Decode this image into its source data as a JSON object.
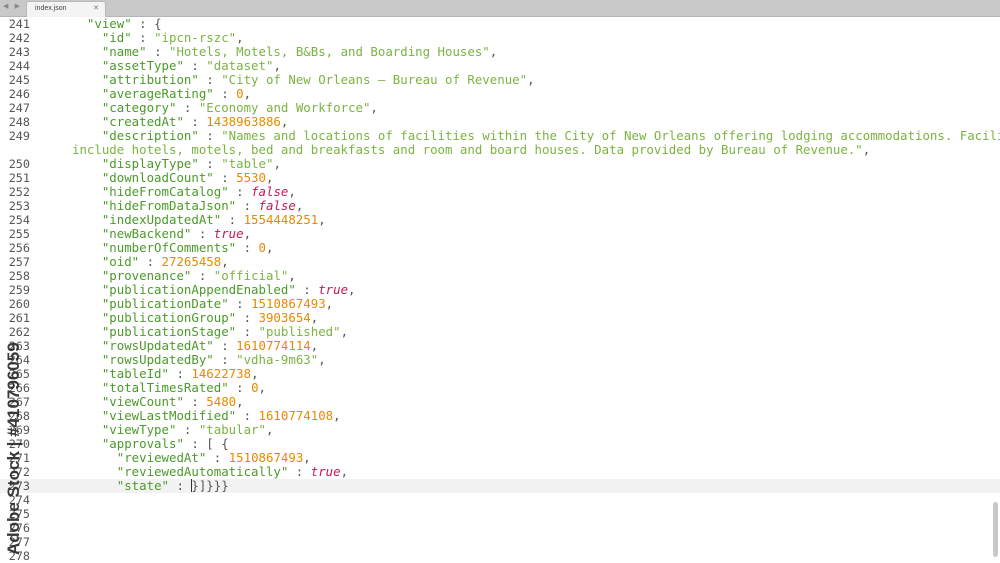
{
  "tab": {
    "label": "index.json",
    "close": "✕",
    "nav": "◀ ▶"
  },
  "watermark": "Adobe Stock | #410796059",
  "lines": [
    {
      "ln": "241",
      "tokens": [
        [
          "p",
          "  "
        ],
        [
          "k",
          "\"view\""
        ],
        [
          "p",
          " : {"
        ]
      ]
    },
    {
      "ln": "242",
      "tokens": [
        [
          "p",
          "    "
        ],
        [
          "k",
          "\"id\""
        ],
        [
          "p",
          " : "
        ],
        [
          "s",
          "\"ipcn-rszc\""
        ],
        [
          "p",
          ","
        ]
      ]
    },
    {
      "ln": "243",
      "tokens": [
        [
          "p",
          "    "
        ],
        [
          "k",
          "\"name\""
        ],
        [
          "p",
          " : "
        ],
        [
          "s",
          "\"Hotels, Motels, B&Bs, and Boarding Houses\""
        ],
        [
          "p",
          ","
        ]
      ]
    },
    {
      "ln": "244",
      "tokens": [
        [
          "p",
          "    "
        ],
        [
          "k",
          "\"assetType\""
        ],
        [
          "p",
          " : "
        ],
        [
          "s",
          "\"dataset\""
        ],
        [
          "p",
          ","
        ]
      ]
    },
    {
      "ln": "245",
      "tokens": [
        [
          "p",
          "    "
        ],
        [
          "k",
          "\"attribution\""
        ],
        [
          "p",
          " : "
        ],
        [
          "s",
          "\"City of New Orleans — Bureau of Revenue\""
        ],
        [
          "p",
          ","
        ]
      ]
    },
    {
      "ln": "246",
      "tokens": [
        [
          "p",
          "    "
        ],
        [
          "k",
          "\"averageRating\""
        ],
        [
          "p",
          " : "
        ],
        [
          "n",
          "0"
        ],
        [
          "p",
          ","
        ]
      ]
    },
    {
      "ln": "247",
      "tokens": [
        [
          "p",
          "    "
        ],
        [
          "k",
          "\"category\""
        ],
        [
          "p",
          " : "
        ],
        [
          "s",
          "\"Economy and Workforce\""
        ],
        [
          "p",
          ","
        ]
      ]
    },
    {
      "ln": "248",
      "tokens": [
        [
          "p",
          "    "
        ],
        [
          "k",
          "\"createdAt\""
        ],
        [
          "p",
          " : "
        ],
        [
          "n",
          "1438963886"
        ],
        [
          "p",
          ","
        ]
      ]
    },
    {
      "ln": "249",
      "tokens": [
        [
          "p",
          "    "
        ],
        [
          "k",
          "\"description\""
        ],
        [
          "p",
          " : "
        ],
        [
          "s",
          "\"Names and locations of facilities within the City of New Orleans offering lodging accommodations. Facilities"
        ]
      ]
    },
    {
      "ln": "",
      "tokens": [
        [
          "s",
          "include hotels, motels, bed and breakfasts and room and board houses. Data provided by Bureau of Revenue.\""
        ],
        [
          "p",
          ","
        ]
      ]
    },
    {
      "ln": "250",
      "tokens": [
        [
          "p",
          "    "
        ],
        [
          "k",
          "\"displayType\""
        ],
        [
          "p",
          " : "
        ],
        [
          "s",
          "\"table\""
        ],
        [
          "p",
          ","
        ]
      ]
    },
    {
      "ln": "251",
      "tokens": [
        [
          "p",
          "    "
        ],
        [
          "k",
          "\"downloadCount\""
        ],
        [
          "p",
          " : "
        ],
        [
          "n",
          "5530"
        ],
        [
          "p",
          ","
        ]
      ]
    },
    {
      "ln": "252",
      "tokens": [
        [
          "p",
          "    "
        ],
        [
          "k",
          "\"hideFromCatalog\""
        ],
        [
          "p",
          " : "
        ],
        [
          "b",
          "false"
        ],
        [
          "p",
          ","
        ]
      ]
    },
    {
      "ln": "253",
      "tokens": [
        [
          "p",
          "    "
        ],
        [
          "k",
          "\"hideFromDataJson\""
        ],
        [
          "p",
          " : "
        ],
        [
          "b",
          "false"
        ],
        [
          "p",
          ","
        ]
      ]
    },
    {
      "ln": "254",
      "tokens": [
        [
          "p",
          "    "
        ],
        [
          "k",
          "\"indexUpdatedAt\""
        ],
        [
          "p",
          " : "
        ],
        [
          "n",
          "1554448251"
        ],
        [
          "p",
          ","
        ]
      ]
    },
    {
      "ln": "255",
      "tokens": [
        [
          "p",
          "    "
        ],
        [
          "k",
          "\"newBackend\""
        ],
        [
          "p",
          " : "
        ],
        [
          "b",
          "true"
        ],
        [
          "p",
          ","
        ]
      ]
    },
    {
      "ln": "256",
      "tokens": [
        [
          "p",
          "    "
        ],
        [
          "k",
          "\"numberOfComments\""
        ],
        [
          "p",
          " : "
        ],
        [
          "n",
          "0"
        ],
        [
          "p",
          ","
        ]
      ]
    },
    {
      "ln": "257",
      "tokens": [
        [
          "p",
          "    "
        ],
        [
          "k",
          "\"oid\""
        ],
        [
          "p",
          " : "
        ],
        [
          "n",
          "27265458"
        ],
        [
          "p",
          ","
        ]
      ]
    },
    {
      "ln": "258",
      "tokens": [
        [
          "p",
          "    "
        ],
        [
          "k",
          "\"provenance\""
        ],
        [
          "p",
          " : "
        ],
        [
          "s",
          "\"official\""
        ],
        [
          "p",
          ","
        ]
      ]
    },
    {
      "ln": "259",
      "tokens": [
        [
          "p",
          "    "
        ],
        [
          "k",
          "\"publicationAppendEnabled\""
        ],
        [
          "p",
          " : "
        ],
        [
          "b",
          "true"
        ],
        [
          "p",
          ","
        ]
      ]
    },
    {
      "ln": "260",
      "tokens": [
        [
          "p",
          "    "
        ],
        [
          "k",
          "\"publicationDate\""
        ],
        [
          "p",
          " : "
        ],
        [
          "n",
          "1510867493"
        ],
        [
          "p",
          ","
        ]
      ]
    },
    {
      "ln": "261",
      "tokens": [
        [
          "p",
          "    "
        ],
        [
          "k",
          "\"publicationGroup\""
        ],
        [
          "p",
          " : "
        ],
        [
          "n",
          "3903654"
        ],
        [
          "p",
          ","
        ]
      ]
    },
    {
      "ln": "262",
      "tokens": [
        [
          "p",
          "    "
        ],
        [
          "k",
          "\"publicationStage\""
        ],
        [
          "p",
          " : "
        ],
        [
          "s",
          "\"published\""
        ],
        [
          "p",
          ","
        ]
      ]
    },
    {
      "ln": "263",
      "tokens": [
        [
          "p",
          "    "
        ],
        [
          "k",
          "\"rowsUpdatedAt\""
        ],
        [
          "p",
          " : "
        ],
        [
          "n",
          "1610774114"
        ],
        [
          "p",
          ","
        ]
      ]
    },
    {
      "ln": "264",
      "tokens": [
        [
          "p",
          "    "
        ],
        [
          "k",
          "\"rowsUpdatedBy\""
        ],
        [
          "p",
          " : "
        ],
        [
          "s",
          "\"vdha-9m63\""
        ],
        [
          "p",
          ","
        ]
      ]
    },
    {
      "ln": "265",
      "tokens": [
        [
          "p",
          "    "
        ],
        [
          "k",
          "\"tableId\""
        ],
        [
          "p",
          " : "
        ],
        [
          "n",
          "14622738"
        ],
        [
          "p",
          ","
        ]
      ]
    },
    {
      "ln": "266",
      "tokens": [
        [
          "p",
          "    "
        ],
        [
          "k",
          "\"totalTimesRated\""
        ],
        [
          "p",
          " : "
        ],
        [
          "n",
          "0"
        ],
        [
          "p",
          ","
        ]
      ]
    },
    {
      "ln": "267",
      "tokens": [
        [
          "p",
          "    "
        ],
        [
          "k",
          "\"viewCount\""
        ],
        [
          "p",
          " : "
        ],
        [
          "n",
          "5480"
        ],
        [
          "p",
          ","
        ]
      ]
    },
    {
      "ln": "268",
      "tokens": [
        [
          "p",
          "    "
        ],
        [
          "k",
          "\"viewLastModified\""
        ],
        [
          "p",
          " : "
        ],
        [
          "n",
          "1610774108"
        ],
        [
          "p",
          ","
        ]
      ]
    },
    {
      "ln": "269",
      "tokens": [
        [
          "p",
          "    "
        ],
        [
          "k",
          "\"viewType\""
        ],
        [
          "p",
          " : "
        ],
        [
          "s",
          "\"tabular\""
        ],
        [
          "p",
          ","
        ]
      ]
    },
    {
      "ln": "270",
      "tokens": [
        [
          "p",
          "    "
        ],
        [
          "k",
          "\"approvals\""
        ],
        [
          "p",
          " : [ {"
        ]
      ]
    },
    {
      "ln": "271",
      "tokens": [
        [
          "p",
          "      "
        ],
        [
          "k",
          "\"reviewedAt\""
        ],
        [
          "p",
          " : "
        ],
        [
          "n",
          "1510867493"
        ],
        [
          "p",
          ","
        ]
      ]
    },
    {
      "ln": "272",
      "tokens": [
        [
          "p",
          "      "
        ],
        [
          "k",
          "\"reviewedAutomatically\""
        ],
        [
          "p",
          " : "
        ],
        [
          "b",
          "true"
        ],
        [
          "p",
          ","
        ]
      ]
    },
    {
      "ln": "273",
      "tokens": [
        [
          "p",
          "      "
        ],
        [
          "k",
          "\"state\""
        ],
        [
          "p",
          " : "
        ],
        [
          "caret",
          ""
        ],
        [
          "p",
          "}]}}}"
        ]
      ],
      "current": true
    },
    {
      "ln": "274",
      "tokens": []
    },
    {
      "ln": "275",
      "tokens": []
    },
    {
      "ln": "276",
      "tokens": []
    },
    {
      "ln": "277",
      "tokens": []
    },
    {
      "ln": "278",
      "tokens": []
    }
  ]
}
